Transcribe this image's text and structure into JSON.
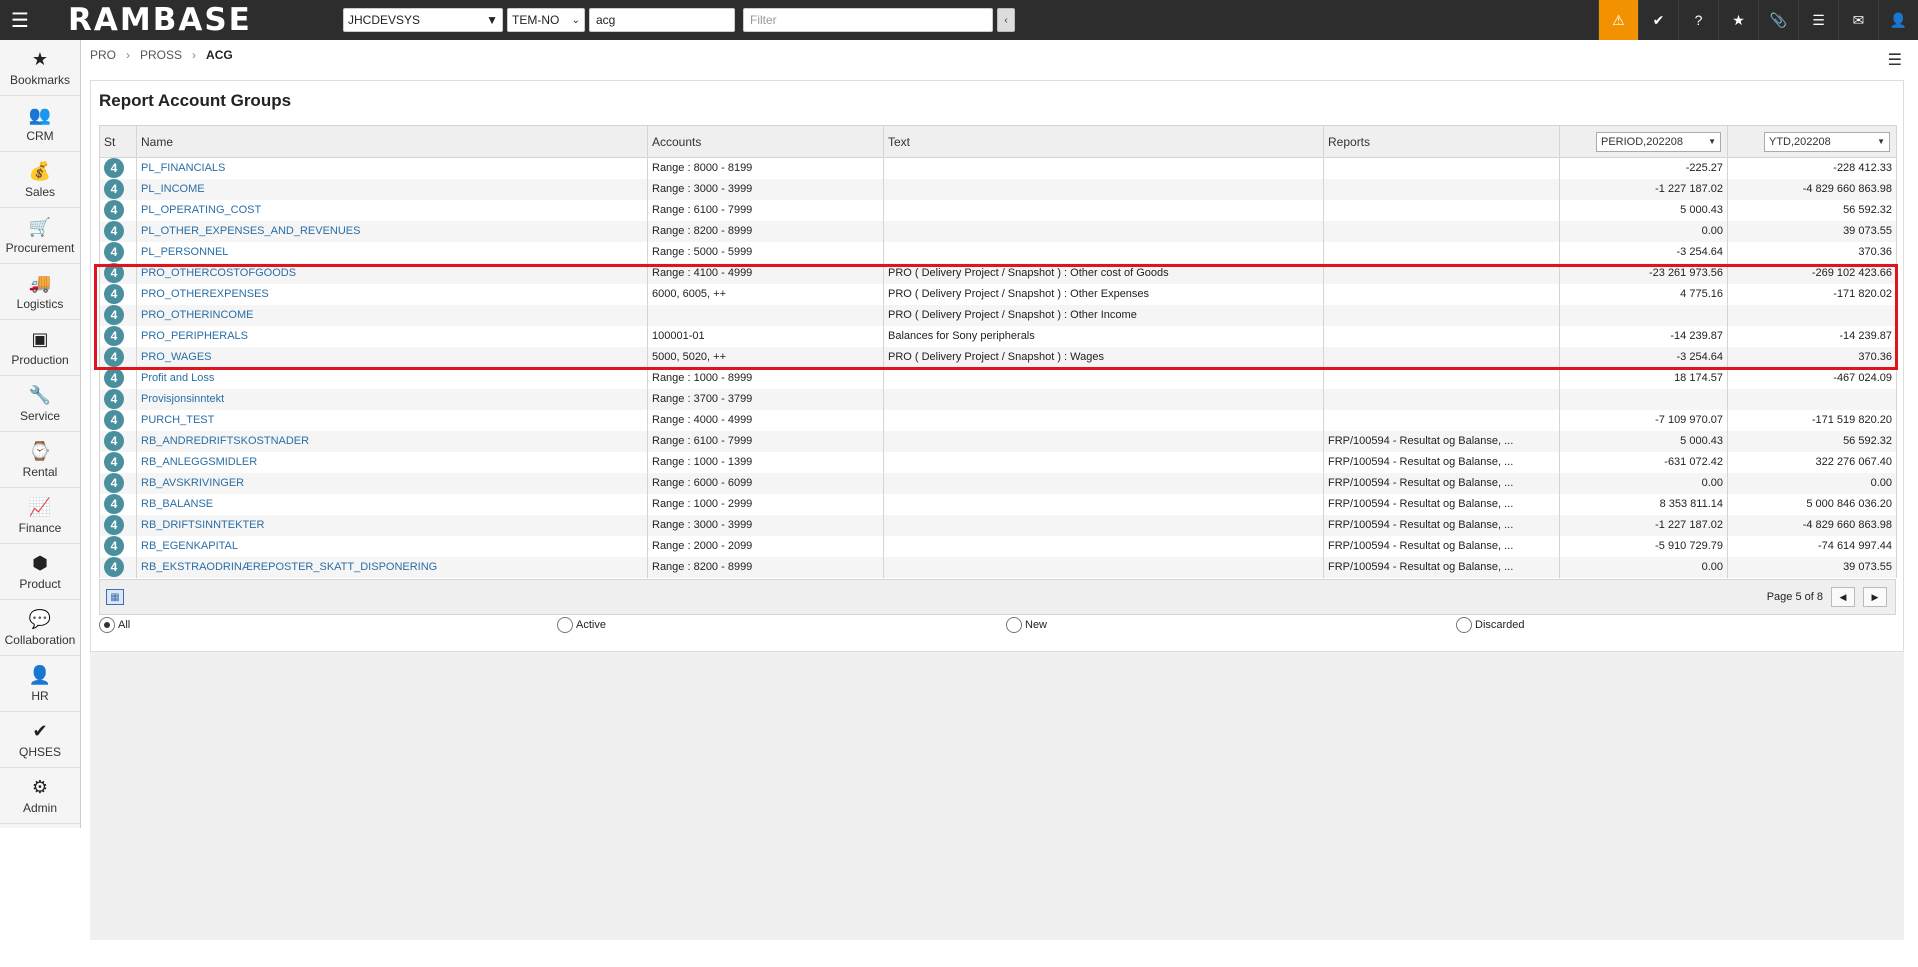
{
  "topbar": {
    "logo": "RAMBASE",
    "company": "JHCDEVSYS",
    "language": "TEM-NO",
    "search_value": "acg",
    "filter_placeholder": "Filter"
  },
  "sidebar": {
    "items": [
      {
        "label": "Bookmarks",
        "icon": "★"
      },
      {
        "label": "CRM",
        "icon": "👥"
      },
      {
        "label": "Sales",
        "icon": "💰"
      },
      {
        "label": "Procurement",
        "icon": "🛒"
      },
      {
        "label": "Logistics",
        "icon": "🚚"
      },
      {
        "label": "Production",
        "icon": "▣"
      },
      {
        "label": "Service",
        "icon": "🔧"
      },
      {
        "label": "Rental",
        "icon": "⌚"
      },
      {
        "label": "Finance",
        "icon": "📈"
      },
      {
        "label": "Product",
        "icon": "⬢"
      },
      {
        "label": "Collaboration",
        "icon": "💬"
      },
      {
        "label": "HR",
        "icon": "👤"
      },
      {
        "label": "QHSES",
        "icon": "✔"
      },
      {
        "label": "Admin",
        "icon": "⚙"
      }
    ]
  },
  "breadcrumb": {
    "a": "PRO",
    "b": "PROSS",
    "c": "ACG"
  },
  "page": {
    "title": "Report Account Groups"
  },
  "grid": {
    "headers": {
      "st": "St",
      "name": "Name",
      "accounts": "Accounts",
      "text": "Text",
      "reports": "Reports"
    },
    "period_select": "PERIOD,202208",
    "ytd_select": "YTD,202208",
    "rows": [
      {
        "st": "4",
        "name": "PL_FINANCIALS",
        "accounts": "Range : 8000 - 8199",
        "text": "",
        "reports": "",
        "period": "-225.27",
        "ytd": "-228 412.33"
      },
      {
        "st": "4",
        "name": "PL_INCOME",
        "accounts": "Range : 3000 - 3999",
        "text": "",
        "reports": "",
        "period": "-1 227 187.02",
        "ytd": "-4 829 660 863.98"
      },
      {
        "st": "4",
        "name": "PL_OPERATING_COST",
        "accounts": "Range : 6100 - 7999",
        "text": "",
        "reports": "",
        "period": "5 000.43",
        "ytd": "56 592.32"
      },
      {
        "st": "4",
        "name": "PL_OTHER_EXPENSES_AND_REVENUES",
        "accounts": "Range : 8200 - 8999",
        "text": "",
        "reports": "",
        "period": "0.00",
        "ytd": "39 073.55"
      },
      {
        "st": "4",
        "name": "PL_PERSONNEL",
        "accounts": "Range : 5000 - 5999",
        "text": "",
        "reports": "",
        "period": "-3 254.64",
        "ytd": "370.36"
      },
      {
        "st": "4",
        "name": "PRO_OTHERCOSTOFGOODS",
        "accounts": "Range : 4100 - 4999",
        "text": "PRO ( Delivery Project / Snapshot ) : Other cost of Goods",
        "reports": "",
        "period": "-23 261 973.56",
        "ytd": "-269 102 423.66"
      },
      {
        "st": "4",
        "name": "PRO_OTHEREXPENSES",
        "accounts": "6000, 6005, ++",
        "text": "PRO ( Delivery Project / Snapshot ) : Other Expenses",
        "reports": "",
        "period": "4 775.16",
        "ytd": "-171 820.02"
      },
      {
        "st": "4",
        "name": "PRO_OTHERINCOME",
        "accounts": "",
        "text": "PRO ( Delivery Project / Snapshot ) : Other Income",
        "reports": "",
        "period": "",
        "ytd": ""
      },
      {
        "st": "4",
        "name": "PRO_PERIPHERALS",
        "accounts": "100001-01",
        "text": "Balances for Sony peripherals",
        "reports": "",
        "period": "-14 239.87",
        "ytd": "-14 239.87"
      },
      {
        "st": "4",
        "name": "PRO_WAGES",
        "accounts": "5000, 5020, ++",
        "text": "PRO ( Delivery Project / Snapshot ) : Wages",
        "reports": "",
        "period": "-3 254.64",
        "ytd": "370.36"
      },
      {
        "st": "4",
        "name": "Profit and Loss",
        "accounts": "Range : 1000 - 8999",
        "text": "",
        "reports": "",
        "period": "18 174.57",
        "ytd": "-467 024.09"
      },
      {
        "st": "4",
        "name": "Provisjonsinntekt",
        "accounts": "Range : 3700 - 3799",
        "text": "",
        "reports": "",
        "period": "",
        "ytd": ""
      },
      {
        "st": "4",
        "name": "PURCH_TEST",
        "accounts": "Range : 4000 - 4999",
        "text": "",
        "reports": "",
        "period": "-7 109 970.07",
        "ytd": "-171 519 820.20"
      },
      {
        "st": "4",
        "name": "RB_ANDREDRIFTSKOSTNADER",
        "accounts": "Range : 6100 - 7999",
        "text": "",
        "reports": "FRP/100594 - Resultat og Balanse, ...",
        "period": "5 000.43",
        "ytd": "56 592.32"
      },
      {
        "st": "4",
        "name": "RB_ANLEGGSMIDLER",
        "accounts": "Range : 1000 - 1399",
        "text": "",
        "reports": "FRP/100594 - Resultat og Balanse, ...",
        "period": "-631 072.42",
        "ytd": "322 276 067.40"
      },
      {
        "st": "4",
        "name": "RB_AVSKRIVINGER",
        "accounts": "Range : 6000 - 6099",
        "text": "",
        "reports": "FRP/100594 - Resultat og Balanse, ...",
        "period": "0.00",
        "ytd": "0.00"
      },
      {
        "st": "4",
        "name": "RB_BALANSE",
        "accounts": "Range : 1000 - 2999",
        "text": "",
        "reports": "FRP/100594 - Resultat og Balanse, ...",
        "period": "8 353 811.14",
        "ytd": "5 000 846 036.20"
      },
      {
        "st": "4",
        "name": "RB_DRIFTSINNTEKTER",
        "accounts": "Range : 3000 - 3999",
        "text": "",
        "reports": "FRP/100594 - Resultat og Balanse, ...",
        "period": "-1 227 187.02",
        "ytd": "-4 829 660 863.98"
      },
      {
        "st": "4",
        "name": "RB_EGENKAPITAL",
        "accounts": "Range : 2000 - 2099",
        "text": "",
        "reports": "FRP/100594 - Resultat og Balanse, ...",
        "period": "-5 910 729.79",
        "ytd": "-74 614 997.44"
      },
      {
        "st": "4",
        "name": "RB_EKSTRAODRINÆREPOSTER_SKATT_DISPONERING",
        "accounts": "Range : 8200 - 8999",
        "text": "",
        "reports": "FRP/100594 - Resultat og Balanse, ...",
        "period": "0.00",
        "ytd": "39 073.55"
      }
    ]
  },
  "footer": {
    "page_text": "Page 5 of 8"
  },
  "filters": {
    "all": "All",
    "active": "Active",
    "new": "New",
    "discarded": "Discarded"
  }
}
